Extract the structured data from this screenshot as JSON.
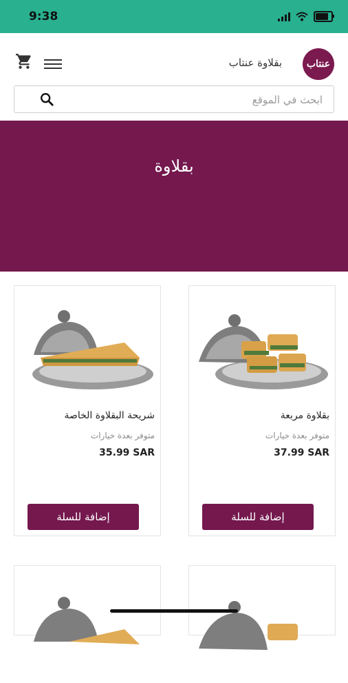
{
  "status": {
    "time": "9:38"
  },
  "header": {
    "brand_name": "بقلاوة عنتاب",
    "logo_text": "عنتاب"
  },
  "search": {
    "placeholder": "ابحث في الموقع"
  },
  "hero": {
    "title": "بقلاوة"
  },
  "products": [
    {
      "name": "بقلاوة مربعة",
      "availability": "متوفر بعدة خيارات",
      "price": "37.99 SAR",
      "add_label": "إضافة للسلة"
    },
    {
      "name": "شريحة البقلاوة الخاصة",
      "availability": "متوفر بعدة خيارات",
      "price": "35.99 SAR",
      "add_label": "إضافة للسلة"
    }
  ],
  "colors": {
    "status_bar": "#28b08f",
    "brand": "#74184e"
  },
  "icons": [
    "cart-icon",
    "menu-icon",
    "search-icon",
    "wifi-icon",
    "battery-icon",
    "signal-icon"
  ]
}
